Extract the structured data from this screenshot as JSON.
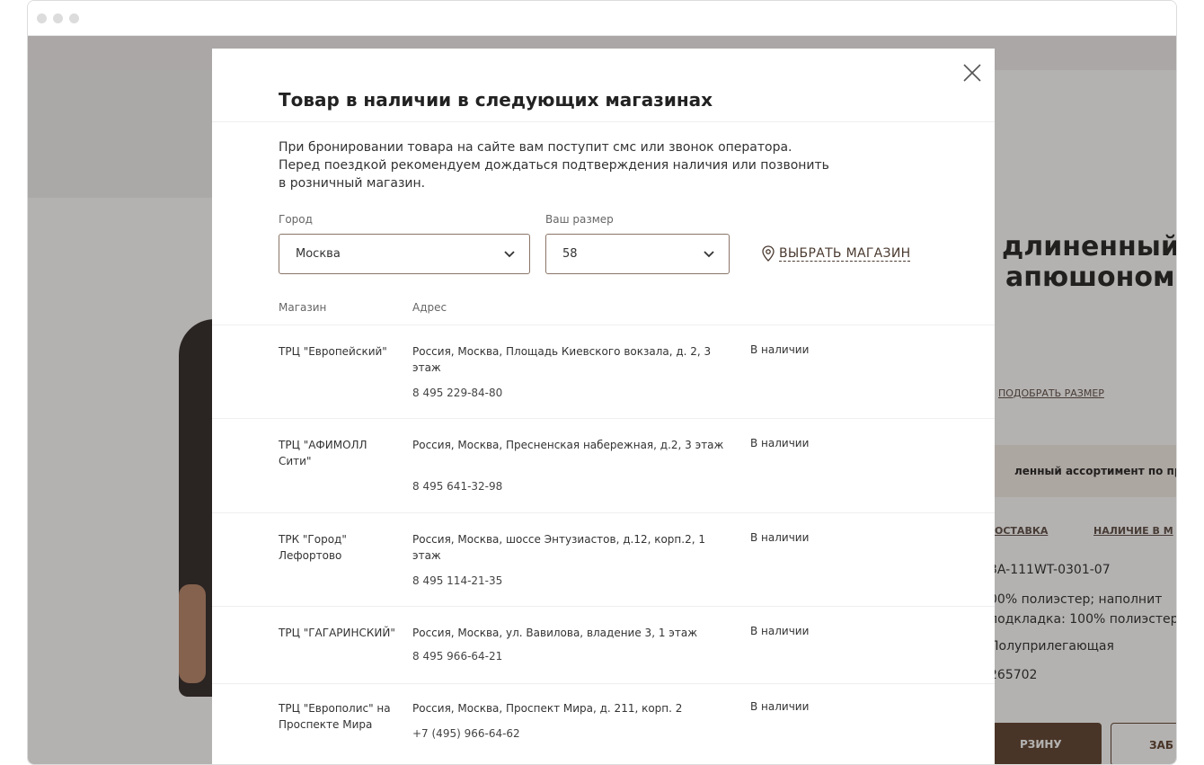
{
  "background": {
    "product_title_lines": [
      "длиненный",
      "апюшоном"
    ],
    "size_link": "ПОДОБРАТЬ РАЗМЕР",
    "promo_text": "ленный ассортимент по пр",
    "tabs": [
      "ОСТАВКА",
      "НАЛИЧИЕ В М"
    ],
    "specs": [
      "3A-111WT-0301-07",
      "00% полиэстер; наполнит",
      "подкладка: 100% полиэстер",
      "Полуприлегающая",
      "265702"
    ],
    "cart_button": "РЗИНУ",
    "fav_button": "ЗАБ"
  },
  "modal": {
    "title": "Товар в наличии в следующих магазинах",
    "intro_lines": [
      "При бронировании товара на сайте вам поступит смс или звонок оператора.",
      "Перед поездкой рекомендуем дождаться подтверждения наличия или позвонить",
      "в розничный магазин."
    ],
    "city_label": "Город",
    "city_value": "Москва",
    "size_label": "Ваш размер",
    "size_value": "58",
    "choose_store": "ВЫБРАТЬ МАГАЗИН",
    "col_store": "Магазин",
    "col_address": "Адрес",
    "stores": [
      {
        "name": "ТРЦ \"Европейский\"",
        "address": "Россия, Москва, Площадь Киевского вокзала, д. 2, 3 этаж",
        "phone": "8 495 229-84-80",
        "status": "В наличии"
      },
      {
        "name": "ТРЦ \"АФИМОЛЛ Сити\"",
        "address": "Россия, Москва, Пресненская набережная, д.2, 3 этаж",
        "phone": "8 495 641-32-98",
        "status": "В наличии"
      },
      {
        "name": "ТРК \"Город\" Лефортово",
        "address": "Россия, Москва, шоссе Энтузиастов, д.12, корп.2, 1 этаж",
        "phone": "8 495 114-21-35",
        "status": "В наличии"
      },
      {
        "name": "ТРЦ \"ГАГАРИНСКИЙ\"",
        "address": "Россия, Москва, ул. Вавилова, владение 3, 1 этаж",
        "phone": "8 495 966-64-21",
        "status": "В наличии"
      },
      {
        "name": "ТРЦ \"Европолис\" на Проспекте Мира",
        "address": "Россия, Москва, Проспект Мира, д. 211, корп. 2",
        "phone": "+7 (495) 966-64-62",
        "status": "В наличии"
      }
    ]
  },
  "icons": {
    "close": "close-icon",
    "chevron": "chevron-down-icon",
    "pin": "map-pin-icon"
  },
  "colors": {
    "accent_brown": "#5b3f2c",
    "select_border": "#8a7568",
    "overlay": "rgba(40,35,32,0.35)"
  }
}
